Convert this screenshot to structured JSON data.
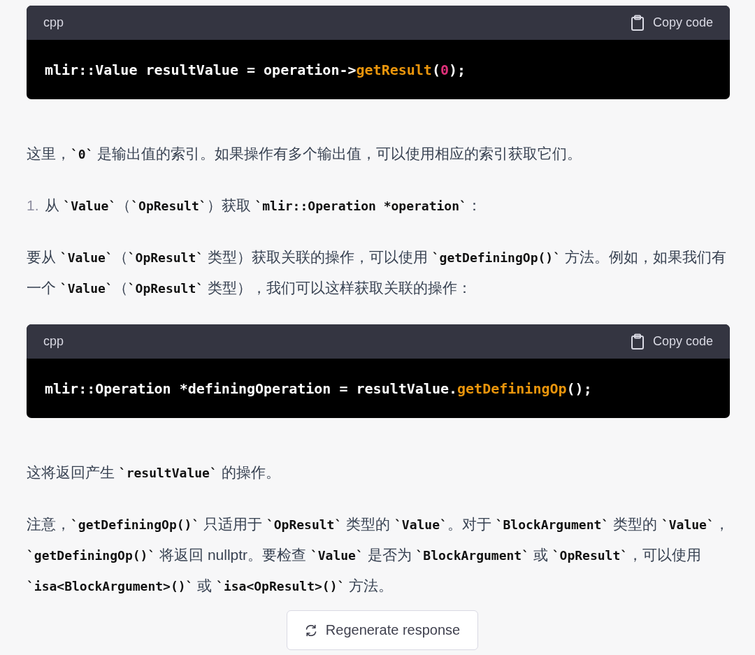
{
  "blocks": [
    {
      "kind": "code",
      "language": "cpp",
      "copy_label": "Copy code",
      "lines": [
        [
          {
            "kind": "plain",
            "text": "mlir::Value resultValue = operation->"
          },
          {
            "kind": "function",
            "text": "getResult"
          },
          {
            "kind": "plain",
            "text": "("
          },
          {
            "kind": "number",
            "text": "0"
          },
          {
            "kind": "plain",
            "text": ");"
          }
        ]
      ]
    },
    {
      "kind": "paragraph",
      "parts": [
        {
          "kind": "text",
          "text": "这里，"
        },
        {
          "kind": "code",
          "text": "`0`"
        },
        {
          "kind": "text",
          "text": " 是输出值的索引。如果操作有多个输出值，可以使用相应的索引获取它们。"
        }
      ]
    },
    {
      "kind": "list_item",
      "number": "1.",
      "parts": [
        {
          "kind": "text",
          "text": "从 "
        },
        {
          "kind": "code",
          "text": "`Value`"
        },
        {
          "kind": "text",
          "text": "（"
        },
        {
          "kind": "code",
          "text": "`OpResult`"
        },
        {
          "kind": "text",
          "text": "）获取 "
        },
        {
          "kind": "code",
          "text": "`mlir::Operation *operation`"
        },
        {
          "kind": "text",
          "text": "："
        }
      ]
    },
    {
      "kind": "paragraph",
      "parts": [
        {
          "kind": "text",
          "text": "要从 "
        },
        {
          "kind": "code",
          "text": "`Value`"
        },
        {
          "kind": "text",
          "text": "（"
        },
        {
          "kind": "code",
          "text": "`OpResult`"
        },
        {
          "kind": "text",
          "text": " 类型）获取关联的操作，可以使用 "
        },
        {
          "kind": "code",
          "text": "`getDefiningOp()`"
        },
        {
          "kind": "text",
          "text": " 方法。例如，如果我们有一个 "
        },
        {
          "kind": "code",
          "text": "`Value`"
        },
        {
          "kind": "text",
          "text": "（"
        },
        {
          "kind": "code",
          "text": "`OpResult`"
        },
        {
          "kind": "text",
          "text": " 类型），我们可以这样获取关联的操作："
        }
      ]
    },
    {
      "kind": "code",
      "language": "cpp",
      "copy_label": "Copy code",
      "lines": [
        [
          {
            "kind": "plain",
            "text": "mlir::Operation *definingOperation = resultValue."
          },
          {
            "kind": "function",
            "text": "getDefiningOp"
          },
          {
            "kind": "plain",
            "text": "();"
          }
        ]
      ]
    },
    {
      "kind": "paragraph",
      "parts": [
        {
          "kind": "text",
          "text": "这将返回产生 "
        },
        {
          "kind": "code",
          "text": "`resultValue`"
        },
        {
          "kind": "text",
          "text": " 的操作。"
        }
      ]
    },
    {
      "kind": "paragraph",
      "parts": [
        {
          "kind": "text",
          "text": "注意，"
        },
        {
          "kind": "code",
          "text": "`getDefiningOp()`"
        },
        {
          "kind": "text",
          "text": " 只适用于 "
        },
        {
          "kind": "code",
          "text": "`OpResult`"
        },
        {
          "kind": "text",
          "text": " 类型的 "
        },
        {
          "kind": "code",
          "text": "`Value`"
        },
        {
          "kind": "text",
          "text": "。对于 "
        },
        {
          "kind": "code",
          "text": "`BlockArgument`"
        },
        {
          "kind": "text",
          "text": " 类型的 "
        },
        {
          "kind": "code",
          "text": "`Value`"
        },
        {
          "kind": "text",
          "text": "，"
        },
        {
          "kind": "code",
          "text": "`getDefiningOp()`"
        },
        {
          "kind": "text",
          "text": " 将返回 nullptr。要检查 "
        },
        {
          "kind": "code",
          "text": "`Value`"
        },
        {
          "kind": "text",
          "text": " 是否为 "
        },
        {
          "kind": "code",
          "text": "`BlockArgument`"
        },
        {
          "kind": "text",
          "text": " 或 "
        },
        {
          "kind": "code",
          "text": "`OpResult`"
        },
        {
          "kind": "text",
          "text": "，可以使用 "
        },
        {
          "kind": "code",
          "text": "`isa<BlockArgument>()`"
        },
        {
          "kind": "text",
          "text": " 或 "
        },
        {
          "kind": "code",
          "text": "`isa<OpResult>()`"
        },
        {
          "kind": "text",
          "text": " 方法。"
        }
      ]
    }
  ],
  "regenerate_button": {
    "label": "Regenerate response"
  }
}
